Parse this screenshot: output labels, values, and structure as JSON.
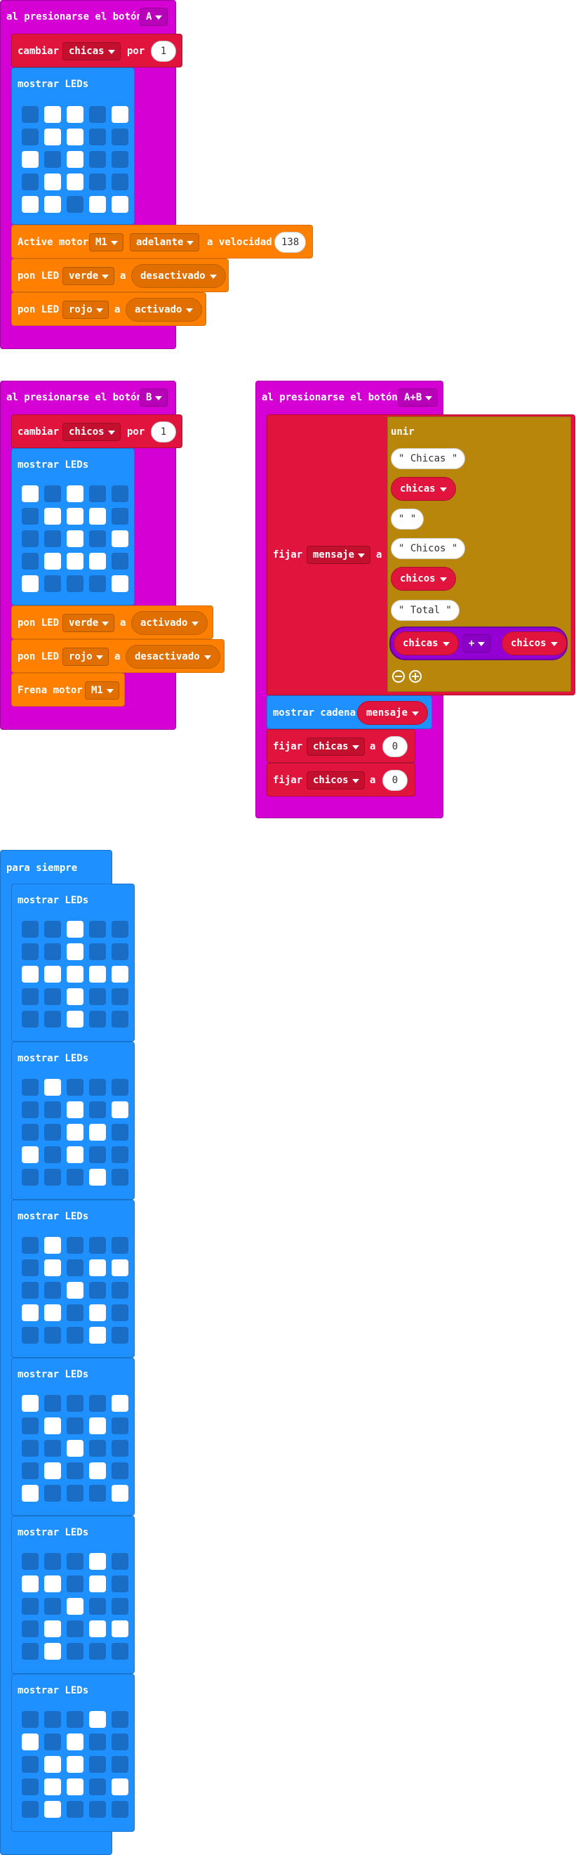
{
  "blocks": {
    "on_a": {
      "header": "al presionarse el botón",
      "button": "A",
      "change": {
        "label": "cambiar",
        "var": "chicas",
        "by": "por",
        "value": "1"
      },
      "show_leds": "mostrar LEDs",
      "leds": [
        [
          0,
          1,
          1,
          0,
          1
        ],
        [
          0,
          1,
          1,
          0,
          0
        ],
        [
          1,
          0,
          1,
          0,
          0
        ],
        [
          0,
          1,
          1,
          0,
          0
        ],
        [
          1,
          1,
          0,
          1,
          1
        ]
      ],
      "motor": {
        "label": "Active motor",
        "motor": "M1",
        "direction": "adelante",
        "speed_label": "a velocidad",
        "speed": "138"
      },
      "led1": {
        "label": "pon LED",
        "color": "verde",
        "to": "a",
        "state": "desactivado"
      },
      "led2": {
        "label": "pon LED",
        "color": "rojo",
        "to": "a",
        "state": "activado"
      }
    },
    "on_b": {
      "header": "al presionarse el botón",
      "button": "B",
      "change": {
        "label": "cambiar",
        "var": "chicos",
        "by": "por",
        "value": "1"
      },
      "show_leds": "mostrar LEDs",
      "leds": [
        [
          1,
          0,
          1,
          0,
          0
        ],
        [
          0,
          1,
          1,
          1,
          0
        ],
        [
          0,
          0,
          1,
          0,
          1
        ],
        [
          0,
          1,
          1,
          1,
          0
        ],
        [
          1,
          0,
          0,
          0,
          1
        ]
      ],
      "led1": {
        "label": "pon LED",
        "color": "verde",
        "to": "a",
        "state": "activado"
      },
      "led2": {
        "label": "pon LED",
        "color": "rojo",
        "to": "a",
        "state": "desactivado"
      },
      "brake": {
        "label": "Frena motor",
        "motor": "M1"
      }
    },
    "on_ab": {
      "header": "al presionarse el botón",
      "button": "A+B",
      "set": {
        "label": "fijar",
        "var": "mensaje",
        "to": "a"
      },
      "join": {
        "label": "unir",
        "items": [
          "Chicas",
          "chicas",
          " ",
          " Chicos ",
          "chicos",
          " Total ",
          "chicas + chicos"
        ],
        "str1": "\" Chicas \"",
        "var1": "chicas",
        "str2": "\" \"",
        "str3": "\" Chicos \"",
        "var2": "chicos",
        "str4": "\" Total \"",
        "sum_left": "chicas",
        "sum_op": "+",
        "sum_right": "chicos"
      },
      "show_string": {
        "label": "mostrar cadena",
        "var": "mensaje"
      },
      "reset1": {
        "label": "fijar",
        "var": "chicas",
        "to": "a",
        "value": "0"
      },
      "reset2": {
        "label": "fijar",
        "var": "chicos",
        "to": "a",
        "value": "0"
      }
    },
    "forever": {
      "header": "para siempre",
      "show_leds": "mostrar LEDs",
      "frames": [
        [
          [
            0,
            0,
            1,
            0,
            0
          ],
          [
            0,
            0,
            1,
            0,
            0
          ],
          [
            1,
            1,
            1,
            1,
            1
          ],
          [
            0,
            0,
            1,
            0,
            0
          ],
          [
            0,
            0,
            1,
            0,
            0
          ]
        ],
        [
          [
            0,
            1,
            0,
            0,
            0
          ],
          [
            0,
            0,
            1,
            0,
            1
          ],
          [
            0,
            0,
            1,
            1,
            0
          ],
          [
            1,
            0,
            1,
            0,
            0
          ],
          [
            0,
            0,
            0,
            1,
            0
          ]
        ],
        [
          [
            0,
            1,
            0,
            0,
            0
          ],
          [
            0,
            1,
            0,
            1,
            1
          ],
          [
            0,
            0,
            1,
            0,
            0
          ],
          [
            1,
            1,
            0,
            1,
            0
          ],
          [
            0,
            0,
            0,
            1,
            0
          ]
        ],
        [
          [
            1,
            0,
            0,
            0,
            1
          ],
          [
            0,
            1,
            0,
            1,
            0
          ],
          [
            0,
            0,
            1,
            0,
            0
          ],
          [
            0,
            1,
            0,
            1,
            0
          ],
          [
            1,
            0,
            0,
            0,
            1
          ]
        ],
        [
          [
            0,
            0,
            0,
            1,
            0
          ],
          [
            1,
            1,
            0,
            1,
            0
          ],
          [
            0,
            0,
            1,
            0,
            0
          ],
          [
            0,
            1,
            0,
            1,
            1
          ],
          [
            0,
            1,
            0,
            0,
            0
          ]
        ],
        [
          [
            0,
            0,
            0,
            1,
            0
          ],
          [
            1,
            0,
            1,
            0,
            0
          ],
          [
            0,
            1,
            1,
            0,
            0
          ],
          [
            0,
            1,
            1,
            0,
            1
          ],
          [
            0,
            1,
            0,
            0,
            0
          ]
        ]
      ]
    }
  },
  "colors": {
    "events": "#d400d4",
    "variables": "#e0143c",
    "basic": "#1e90ff",
    "motor": "#ff8000",
    "text": "#b8860b",
    "math": "#9400d3"
  }
}
